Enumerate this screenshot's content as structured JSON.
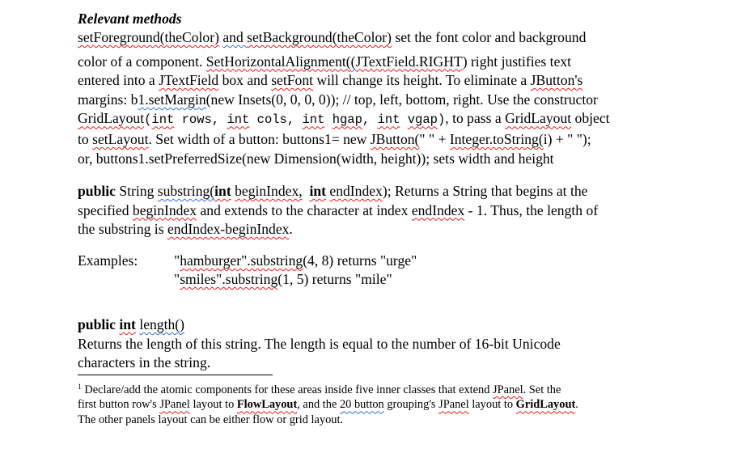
{
  "section1": {
    "heading": "Relevant methods",
    "line1": {
      "a": "setForeground(theColor)",
      "b": " ",
      "c": "and ",
      "d": "setBackground(theColor)",
      "e": " set the font color and background"
    },
    "line2": {
      "a": "color of a component. ",
      "b": "SetHorizontalAlignment(",
      "c": "(",
      "d": "JTextField.RIGHT",
      "e": ") right justifies text"
    },
    "line3": {
      "a": "entered into a ",
      "b": "JTextField",
      "c": " box and ",
      "d": "setFont",
      "e": " will change its height. To eliminate a ",
      "f": "JButton's"
    },
    "line4": {
      "a": "margins: b",
      "b": "1.setMargin",
      "c": "(new Insets(0, 0, 0, 0)); // top, left, bottom, right. Use the constructor"
    },
    "line5": {
      "a": "GridLayout",
      "b": "(",
      "c": "int",
      "d": " rows, ",
      "e": "int",
      "f": " cols, ",
      "g": "int",
      "h": " ",
      "i": "hgap",
      "j": ", ",
      "k": "int",
      "l": " ",
      "m": "vgap",
      "n": ")",
      "o": ", to pass a ",
      "p": "GridLayout",
      "q": " object"
    },
    "line6": {
      "a": "to ",
      "b": "setLayout",
      "c": ". Set width of a button: buttons1= new ",
      "d": "JButton(",
      "e": "\" \" + ",
      "f": "Integer.toString(",
      "g": "i) + \" \");"
    },
    "line7": "or, buttons1.setPreferredSize(new Dimension(width, height)); sets width and height"
  },
  "section2": {
    "line1": {
      "a": "public",
      "b": " String ",
      "c": "substring(",
      "d": "int",
      "e": " ",
      "f": "beginIndex,",
      "g": "  ",
      "h": "int",
      "i": " ",
      "j": "endIndex",
      "k": "); Returns a String that begins at the"
    },
    "line2": {
      "a": "specified ",
      "b": "beginIndex",
      "c": " and extends to the character at index ",
      "d": "endIndex",
      "e": " - 1. Thus, the length of"
    },
    "line3": {
      "a": "the substring is ",
      "b": "endIndex-beginIndex",
      "c": "."
    }
  },
  "examples": {
    "label": "Examples:",
    "items": [
      {
        "a": "\"",
        "b": "hamburger\".substring",
        "c": "(4, 8) returns \"urge\""
      },
      {
        "a": "\"",
        "b": "smiles\".substring",
        "c": "(1, 5) returns \"mile\""
      }
    ]
  },
  "section3": {
    "signature": {
      "a": "public",
      "b": " ",
      "c": "int",
      "d": " ",
      "e": "length()"
    },
    "line1": "Returns the length of this string. The length is equal to the number of 16-bit Unicode",
    "line2": "characters in the string."
  },
  "footnote": {
    "marker": "1",
    "line1": {
      "a": " Declare/add the atomic components for these areas inside five inner classes that extend ",
      "b": "JPanel",
      "c": ". Set the"
    },
    "line2": {
      "a": "first button row's ",
      "b": "JPanel",
      "c": " layout to ",
      "d": "FlowLayout",
      "e": ", and the ",
      "f": "20 button",
      "g": " grouping's ",
      "h": "JPanel",
      "i": " layout to ",
      "j": "GridLayout",
      "k": "."
    },
    "line3": "The other panels layout can be either flow or grid layout."
  }
}
